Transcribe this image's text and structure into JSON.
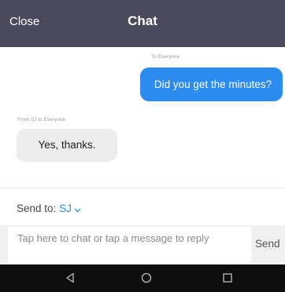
{
  "header": {
    "close_label": "Close",
    "title": "Chat"
  },
  "messages": [
    {
      "direction": "outgoing",
      "meta": "To Everyone",
      "text": "Did you get the minutes?"
    },
    {
      "direction": "incoming",
      "meta": "From SJ to Everyone",
      "text": "Yes, thanks."
    }
  ],
  "composer": {
    "send_to_label": "Send to:",
    "send_to_value": "SJ",
    "placeholder": "Tap here to chat or tap a message to reply",
    "send_label": "Send"
  },
  "navbar": {
    "icons": [
      "back-icon",
      "home-icon",
      "recents-icon"
    ]
  },
  "colors": {
    "header_bg": "#4a4a5c",
    "accent": "#2d8cf0",
    "incoming_bubble": "#ececec",
    "navbar_bg": "#0e0e0e"
  }
}
